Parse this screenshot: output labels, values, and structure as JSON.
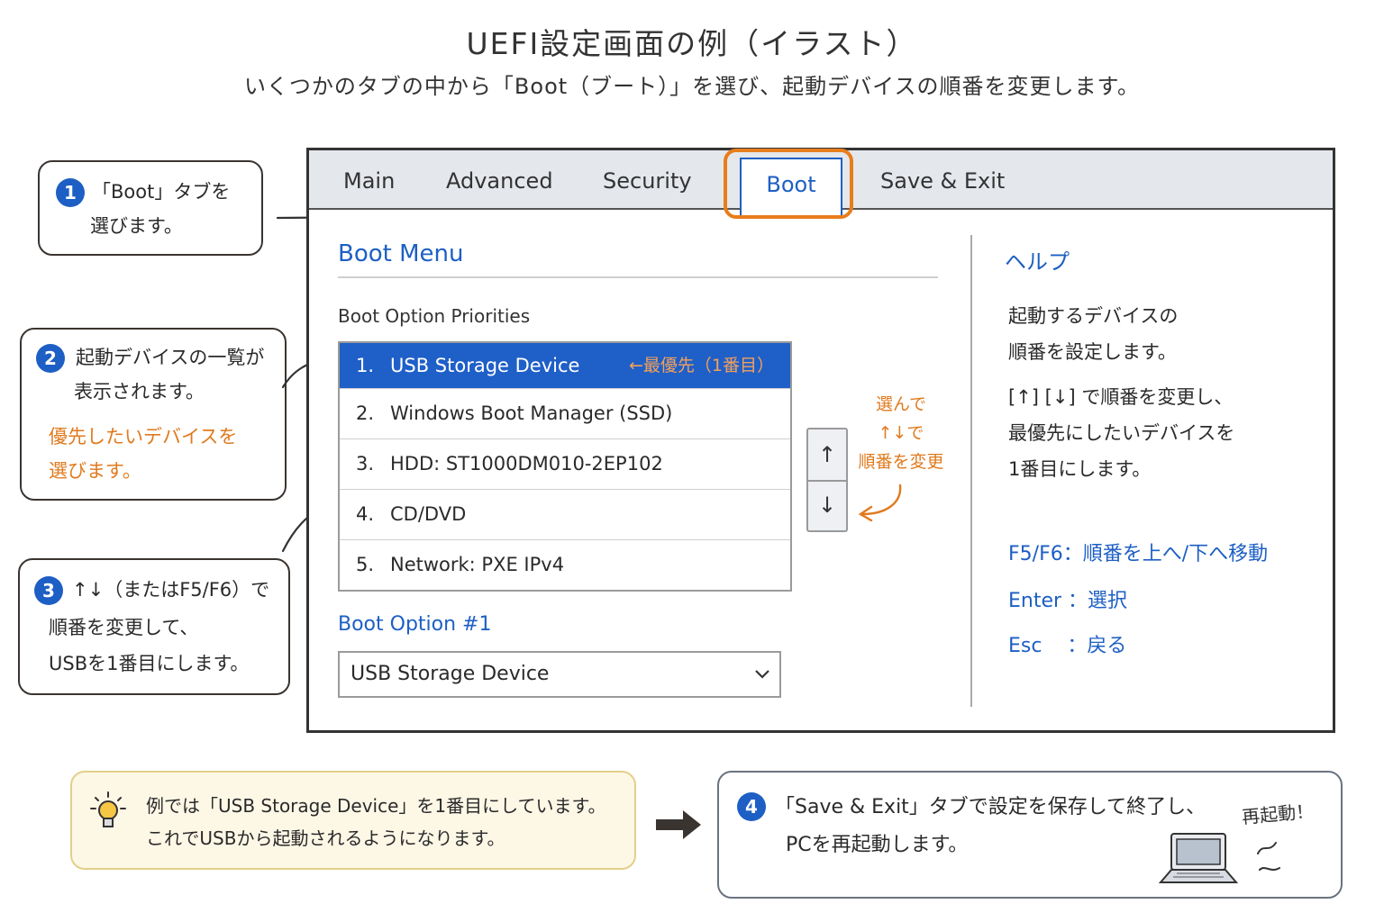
{
  "header": {
    "title": "UEFI設定画面の例（イラスト）",
    "subtitle": "いくつかのタブの中から「Boot（ブート）」を選び、起動デバイスの順番を変更します。"
  },
  "callouts": [
    {
      "badge": "1",
      "lines": [
        "「Boot」タブを",
        "選びます。"
      ]
    },
    {
      "badge": "2",
      "lines": [
        "起動デバイスの一覧が",
        "表示されます。"
      ],
      "highlight": [
        "優先したいデバイスを",
        "選びます。"
      ]
    },
    {
      "badge": "3",
      "lines": [
        "↑↓（またはF5/F6）で",
        "順番を変更して、",
        "USBを1番目にします。"
      ]
    }
  ],
  "bios": {
    "tabs": [
      "Main",
      "Advanced",
      "Security",
      "Boot",
      "Save & Exit"
    ],
    "active_tab": "Boot",
    "menu_title": "Boot Menu",
    "priorities_label": "Boot Option Priorities",
    "devices": [
      {
        "num": "1.",
        "label": "USB Storage Device",
        "tag": "←最優先（1番目）"
      },
      {
        "num": "2.",
        "label": "Windows Boot Manager (SSD)"
      },
      {
        "num": "3.",
        "label": "HDD: ST1000DM010-2EP102"
      },
      {
        "num": "4.",
        "label": "CD/DVD"
      },
      {
        "num": "5.",
        "label": "Network: PXE IPv4"
      }
    ],
    "arrow_up": "↑",
    "arrow_down": "↓",
    "side_note": [
      "選んで",
      "↑↓で",
      "順番を変更"
    ],
    "option_label": "Boot Option #1",
    "option_value": "USB Storage Device",
    "help": {
      "title": "ヘルプ",
      "lines": [
        "起動するデバイスの",
        "順番を設定します。",
        "[↑] [↓] で順番を変更し、",
        "最優先にしたいデバイスを",
        "1番目にします。"
      ],
      "keys": [
        "F5/F6：順番を上へ/下へ移動",
        "Enter ：選択",
        "Esc    ：戻る"
      ]
    }
  },
  "tip": {
    "lines": [
      "例では「USB Storage Device」を1番目にしています。",
      "これでUSBから起動されるようになります。"
    ]
  },
  "step4": {
    "badge": "4",
    "lines": [
      "「Save & Exit」タブで設定を保存して終了し、",
      "PCを再起動します。"
    ],
    "restart": "再起動！"
  },
  "colors": {
    "accent_blue": "#1d5fc4",
    "highlight_orange": "#e87d1c",
    "selected_row": "#1f5fc8"
  }
}
